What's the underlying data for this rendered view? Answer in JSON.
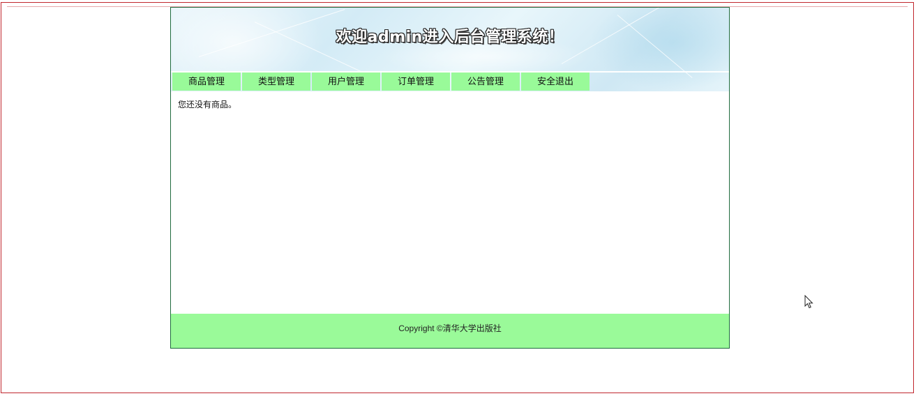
{
  "banner": {
    "title": "欢迎admin进入后台管理系统！"
  },
  "nav": {
    "items": [
      {
        "label": "商品管理"
      },
      {
        "label": "类型管理"
      },
      {
        "label": "用户管理"
      },
      {
        "label": "订单管理"
      },
      {
        "label": "公告管理"
      },
      {
        "label": "安全退出"
      }
    ]
  },
  "content": {
    "empty_message": "您还没有商品。"
  },
  "footer": {
    "copyright": "Copyright ©清华大学出版社"
  },
  "colors": {
    "nav_bg": "#99fa99",
    "footer_bg": "#9afa99",
    "frame_border": "#c0262d",
    "container_border": "#1e6b3d"
  }
}
